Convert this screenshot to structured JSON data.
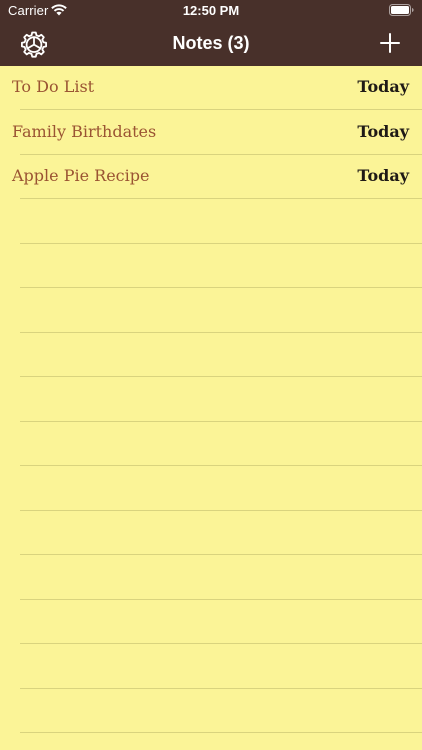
{
  "status_bar": {
    "carrier": "Carrier",
    "time": "12:50 PM",
    "icons": [
      "wifi-icon",
      "battery-icon"
    ]
  },
  "nav": {
    "title": "Notes (3)",
    "left_icon": "settings-gear-icon",
    "right_icon": "plus-icon"
  },
  "notes": [
    {
      "title": "To Do List",
      "date": "Today"
    },
    {
      "title": "Family Birthdates",
      "date": "Today"
    },
    {
      "title": "Apple Pie Recipe",
      "date": "Today"
    }
  ],
  "colors": {
    "header_background": "#48302a",
    "paper_background": "#fbf497",
    "note_title": "#9a5433",
    "note_date": "#1f1a16",
    "rule_line": "#d9d37e"
  }
}
